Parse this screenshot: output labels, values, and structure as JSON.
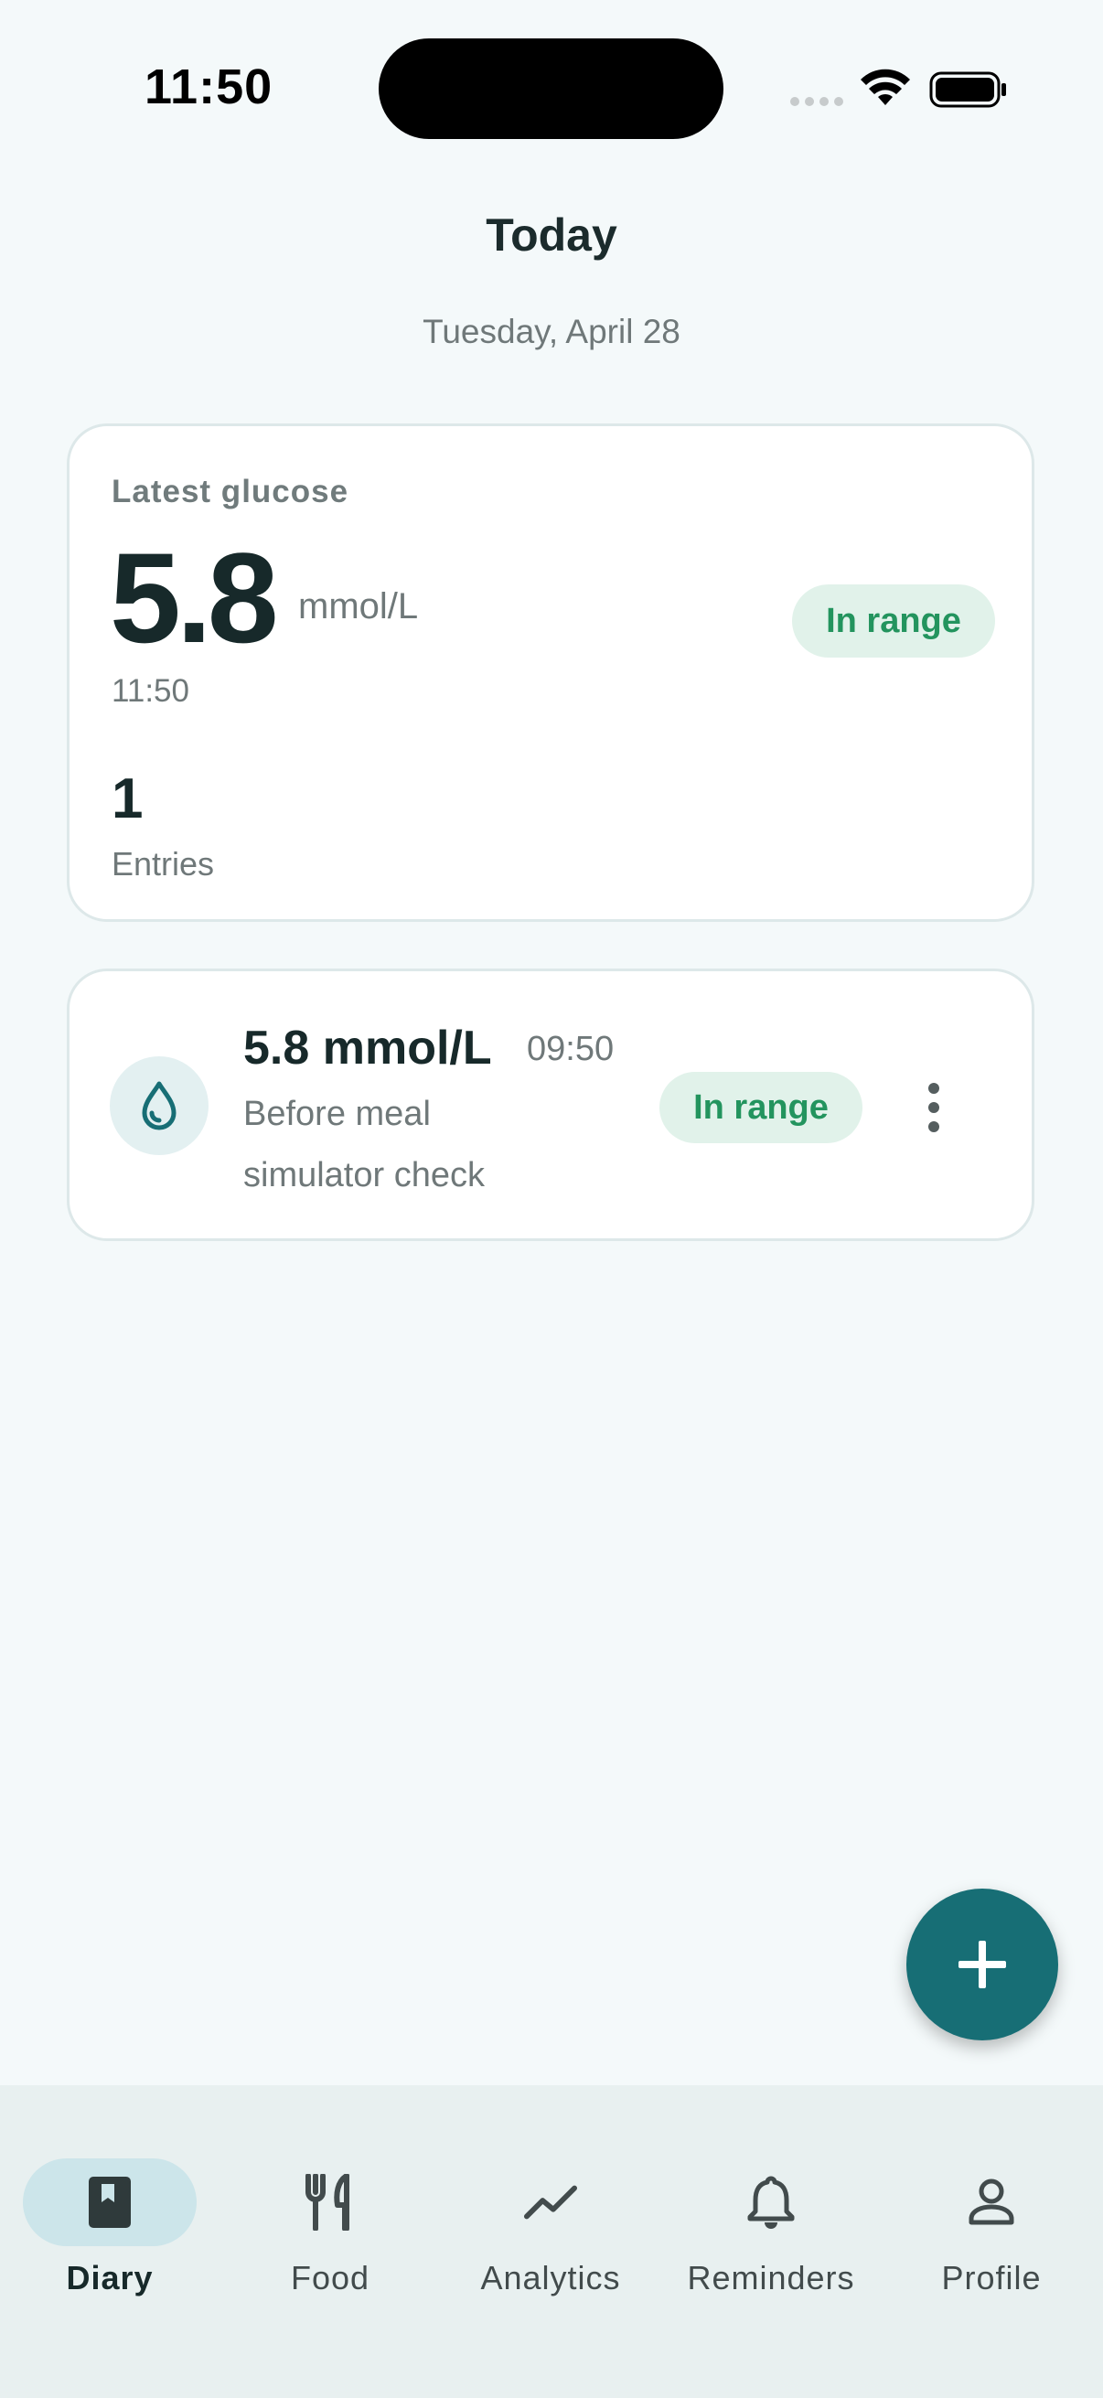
{
  "status_bar": {
    "time": "11:50"
  },
  "header": {
    "title": "Today",
    "date": "Tuesday, April 28"
  },
  "summary": {
    "label": "Latest glucose",
    "value": "5.8",
    "unit": "mmol/L",
    "time": "11:50",
    "status": "In range",
    "entries_count": "1",
    "entries_label": "Entries"
  },
  "entries": [
    {
      "value": "5.8 mmol/L",
      "time": "09:50",
      "context": "Before meal",
      "note": "simulator check",
      "status": "In range",
      "icon": "droplet-icon"
    }
  ],
  "fab": {
    "icon": "plus-icon"
  },
  "nav": {
    "active": "Diary",
    "items": [
      {
        "label": "Diary",
        "icon": "book-icon"
      },
      {
        "label": "Food",
        "icon": "fork-knife-icon"
      },
      {
        "label": "Analytics",
        "icon": "trend-icon"
      },
      {
        "label": "Reminders",
        "icon": "bell-icon"
      },
      {
        "label": "Profile",
        "icon": "person-icon"
      }
    ]
  },
  "colors": {
    "primary": "#176e75",
    "in_range_bg": "#e1f2ea",
    "in_range_text": "#23945e",
    "background": "#f4f9fa",
    "nav_background": "#e8f0f0",
    "nav_active_pill": "#cce5ea"
  }
}
